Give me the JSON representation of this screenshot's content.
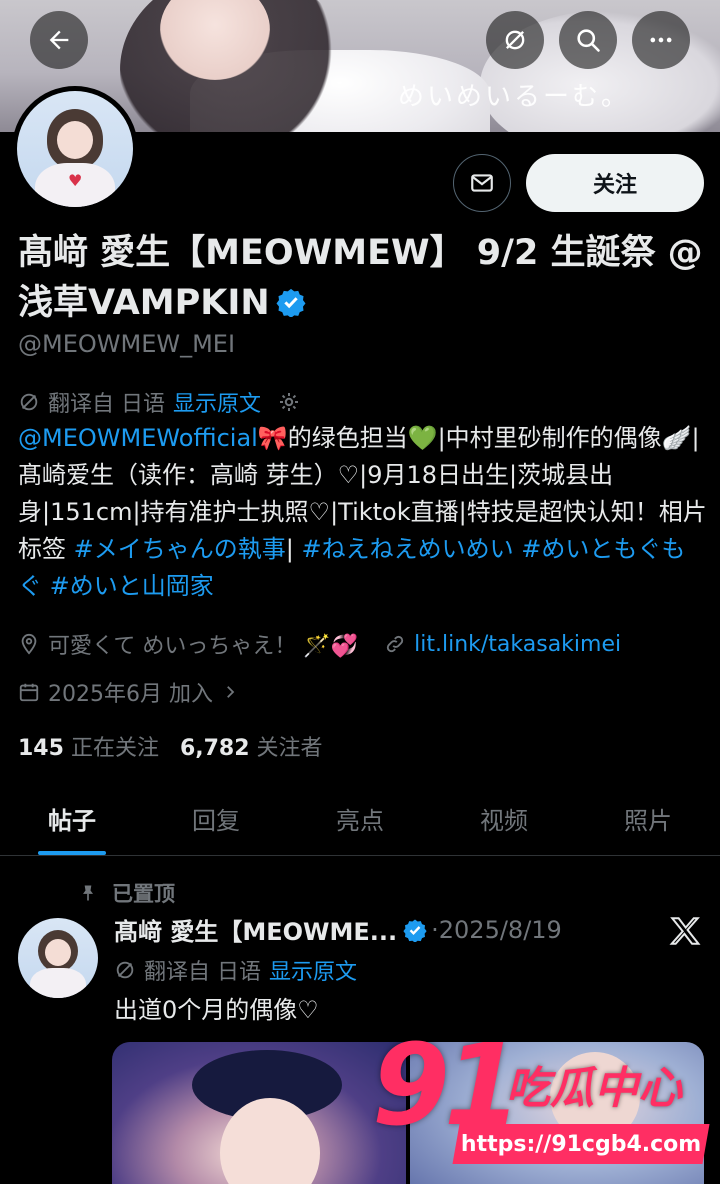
{
  "banner": {
    "caption": "めいめいるーむ。"
  },
  "header": {
    "back_icon": "back-arrow-icon",
    "grok_icon": "grok-icon",
    "search_icon": "search-icon",
    "more_icon": "more-icon"
  },
  "actions": {
    "message_icon": "mail-icon",
    "follow_label": "关注"
  },
  "profile": {
    "display_name": "髙﨑 愛生【MEOWMEW】 9/2 生誕祭 @浅草VAMPKIN",
    "handle": "@MEOWMEW_MEI",
    "translate_label": "翻译自 日语",
    "show_original": "显示原文",
    "bio_parts": {
      "mention": "@MEOWMEWofficial",
      "p1": "🎀的绿色担当💚|中村里砂制作的偶像🪽|髙崎爱生（读作：高崎 芽生）♡|9月18日出生|茨城县出身|151cm|持有准护士执照♡|Tiktok直播|特技是超快认知！相片标签 ",
      "tag1": "#メイちゃんの執事",
      "p2": "| ",
      "tag2": "#ねえねえめいめい",
      "p3": " ",
      "tag3": "#めいともぐもぐ",
      "p4": " ",
      "tag4": "#めいと山岡家"
    },
    "location": "可愛くて めいっちゃえ！ 🪄💞",
    "website": "lit.link/takasakimei",
    "joined": "2025年6月 加入",
    "following_count": "145",
    "following_label": "正在关注",
    "followers_count": "6,782",
    "followers_label": "关注者"
  },
  "tabs": [
    {
      "label": "帖子",
      "active": true
    },
    {
      "label": "回复",
      "active": false
    },
    {
      "label": "亮点",
      "active": false
    },
    {
      "label": "视频",
      "active": false
    },
    {
      "label": "照片",
      "active": false
    }
  ],
  "post": {
    "pinned_label": "已置顶",
    "author": "髙﨑 愛生【MEOWME...",
    "date": "·2025/8/19",
    "translate_label": "翻译自 日语",
    "show_original": "显示原文",
    "text": "出道0个月的偶像♡"
  },
  "watermark": {
    "number": "91",
    "title": "吃瓜中心",
    "url": "https://91cgb4.com"
  },
  "colors": {
    "accent": "#1d9bf0",
    "muted": "#71767b",
    "watermark": "#ff2e63"
  }
}
